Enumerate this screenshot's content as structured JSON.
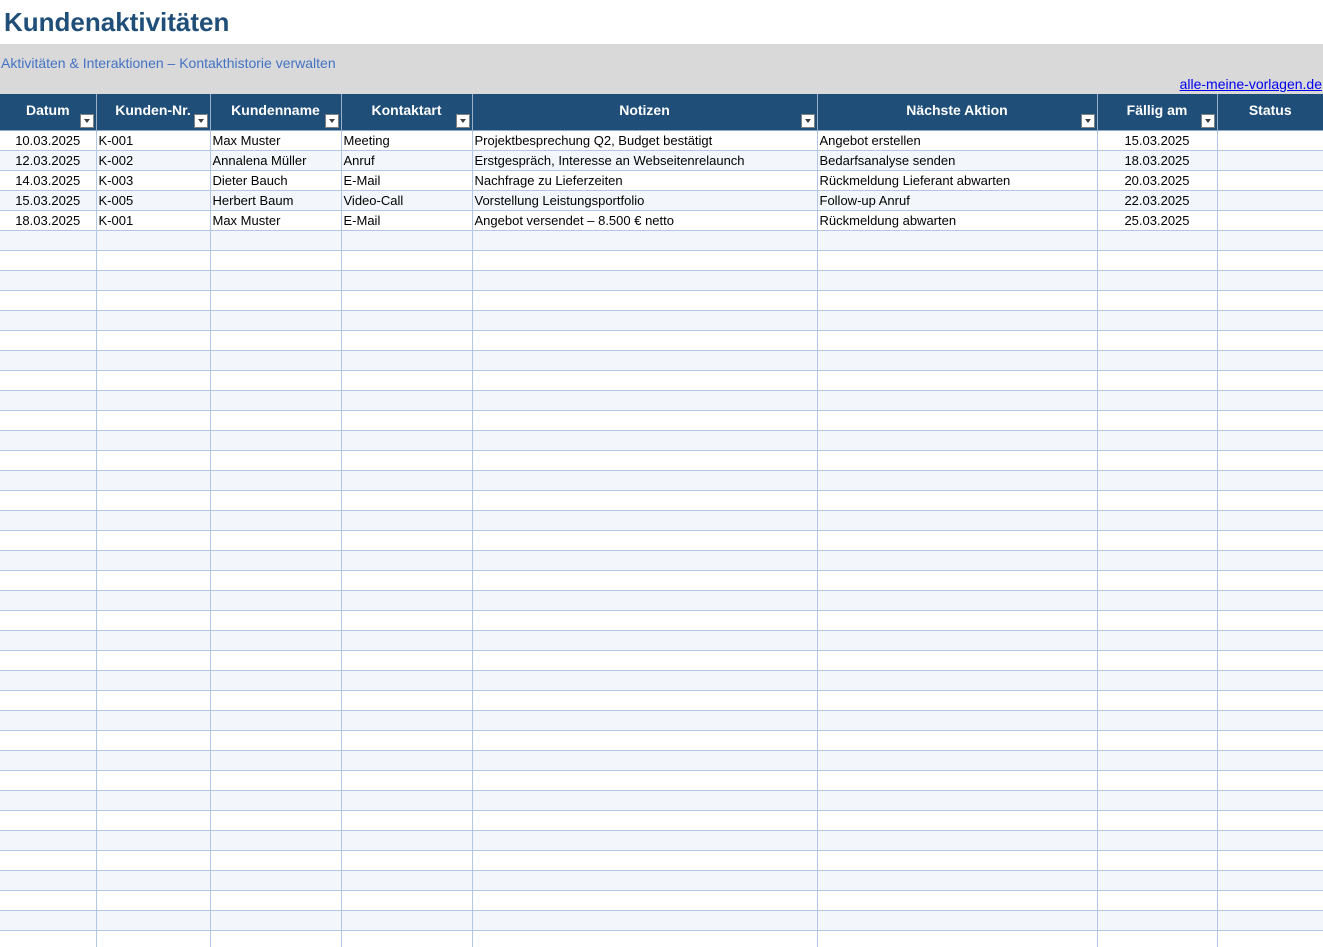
{
  "title": "Kundenaktivitäten",
  "subtitle": "Aktivitäten & Interaktionen – Kontakthistorie verwalten",
  "link": "alle-meine-vorlagen.de",
  "columns": [
    {
      "label": "Datum",
      "filter": true
    },
    {
      "label": "Kunden-Nr.",
      "filter": true
    },
    {
      "label": "Kundenname",
      "filter": true
    },
    {
      "label": "Kontaktart",
      "filter": true
    },
    {
      "label": "Notizen",
      "filter": true
    },
    {
      "label": "Nächste Aktion",
      "filter": true
    },
    {
      "label": "Fällig am",
      "filter": true
    },
    {
      "label": "Status",
      "filter": false
    }
  ],
  "rows": [
    [
      "10.03.2025",
      "K-001",
      "Max Muster",
      "Meeting",
      "Projektbesprechung Q2, Budget bestätigt",
      "Angebot erstellen",
      "15.03.2025",
      ""
    ],
    [
      "12.03.2025",
      "K-002",
      "Annalena Müller",
      "Anruf",
      "Erstgespräch, Interesse an Webseitenrelaunch",
      "Bedarfsanalyse senden",
      "18.03.2025",
      ""
    ],
    [
      "14.03.2025",
      "K-003",
      "Dieter Bauch",
      "E-Mail",
      "Nachfrage zu Lieferzeiten",
      "Rückmeldung Lieferant abwarten",
      "20.03.2025",
      ""
    ],
    [
      "15.03.2025",
      "K-005",
      "Herbert Baum",
      "Video-Call",
      "Vorstellung Leistungsportfolio",
      "Follow-up Anruf",
      "22.03.2025",
      ""
    ],
    [
      "18.03.2025",
      "K-001",
      "Max Muster",
      "E-Mail",
      "Angebot versendet – 8.500 € netto",
      "Rückmeldung abwarten",
      "25.03.2025",
      ""
    ]
  ],
  "colors": {
    "header_bg": "#1f4e79",
    "title": "#1f4e79",
    "subtitle": "#4472c4",
    "band_bg": "#d9d9d9",
    "stripe": "#f3f7fc",
    "gridline": "#b4c6e7"
  }
}
